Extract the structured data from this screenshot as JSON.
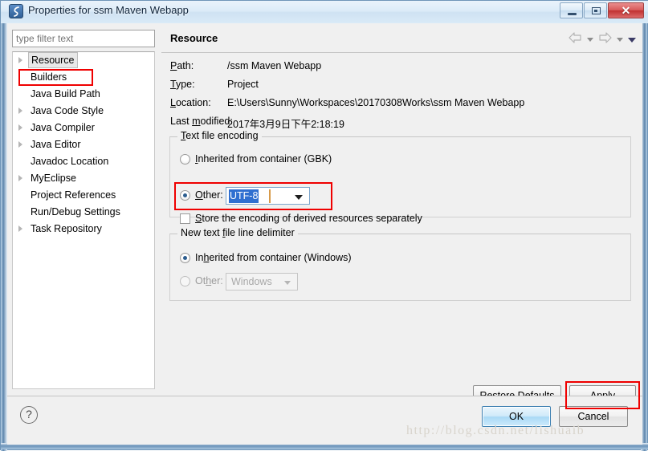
{
  "window": {
    "title": "Properties for ssm Maven Webapp",
    "icon": "myeclipse-icon",
    "controls": {
      "minimize": "minimize-button",
      "maximize": "restore-button",
      "close": "✕"
    }
  },
  "sidebar": {
    "filter_placeholder": "type filter text",
    "filter_value": "",
    "items": [
      {
        "label": "Resource",
        "expandable": true,
        "selected": true
      },
      {
        "label": "Builders",
        "expandable": false,
        "selected": false
      },
      {
        "label": "Java Build Path",
        "expandable": false,
        "selected": false
      },
      {
        "label": "Java Code Style",
        "expandable": true,
        "selected": false
      },
      {
        "label": "Java Compiler",
        "expandable": true,
        "selected": false
      },
      {
        "label": "Java Editor",
        "expandable": true,
        "selected": false
      },
      {
        "label": "Javadoc Location",
        "expandable": false,
        "selected": false
      },
      {
        "label": "MyEclipse",
        "expandable": true,
        "selected": false
      },
      {
        "label": "Project References",
        "expandable": false,
        "selected": false
      },
      {
        "label": "Run/Debug Settings",
        "expandable": false,
        "selected": false
      },
      {
        "label": "Task Repository",
        "expandable": true,
        "selected": false
      }
    ]
  },
  "main": {
    "title": "Resource",
    "nav": {
      "back": "back-arrow",
      "forward": "forward-arrow",
      "menu": "view-menu"
    },
    "properties": [
      {
        "label": "Path:",
        "mnemonic": "P",
        "value": "/ssm Maven Webapp"
      },
      {
        "label": "Type:",
        "mnemonic": "T",
        "value": "Project"
      },
      {
        "label": "Location:",
        "mnemonic": "L",
        "value": "E:\\Users\\Sunny\\Workspaces\\20170308Works\\ssm Maven Webapp"
      },
      {
        "label": "Last modified:",
        "mnemonic": "m",
        "value": "2017年3月9日下午2:18:19"
      }
    ],
    "encoding_group": {
      "title": "Text file encoding",
      "inherited_label": "Inherited from container (GBK)",
      "inherited_selected": false,
      "other_label": "Other:",
      "other_selected": true,
      "other_value": "UTF-8",
      "store_label": "Store the encoding of derived resources separately",
      "store_checked": false
    },
    "delimiter_group": {
      "title": "New text file line delimiter",
      "inherited_label": "Inherited from container (Windows)",
      "inherited_selected": true,
      "other_label": "Other:",
      "other_selected": false,
      "other_value": "Windows",
      "other_disabled": true
    },
    "restore_defaults_label": "Restore Defaults",
    "apply_label": "Apply"
  },
  "footer": {
    "help": "?",
    "ok_label": "OK",
    "cancel_label": "Cancel"
  },
  "watermark": "http://blog.csdn.net/lishuaib",
  "colors": {
    "annotation": "#ef0000",
    "selection_blue": "#2f6fd0",
    "default_button": "#a9d9f5"
  }
}
